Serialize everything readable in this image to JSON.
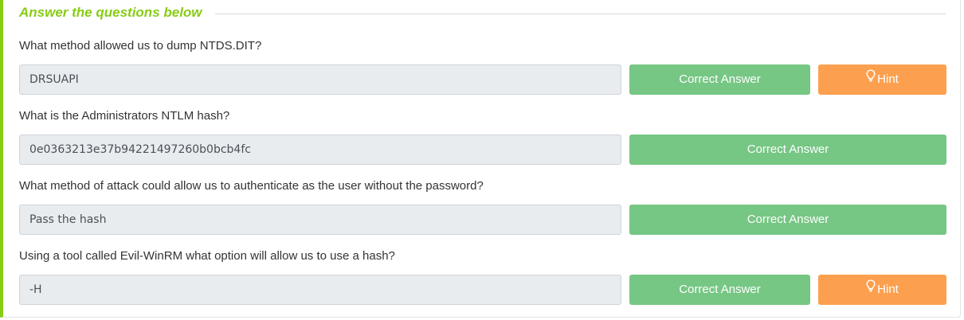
{
  "section": {
    "title": "Answer the questions below"
  },
  "questions": [
    {
      "text": "What method allowed us to dump NTDS.DIT?",
      "answer": "DRSUAPI",
      "status_label": "Correct Answer",
      "hint_label": "Hint"
    },
    {
      "text": "What is the Administrators NTLM hash?",
      "answer": "0e0363213e37b94221497260b0bcb4fc",
      "status_label": "Correct Answer"
    },
    {
      "text": "What method of attack could allow us to authenticate as the user without the password?",
      "answer": "Pass the hash",
      "status_label": "Correct Answer"
    },
    {
      "text": "Using a tool called Evil-WinRM what option will allow us to use a hash?",
      "answer": "-H",
      "status_label": "Correct Answer",
      "hint_label": "Hint"
    }
  ],
  "colors": {
    "accent_green": "#88cc14",
    "correct_button": "#76c684",
    "hint_button": "#fca04f",
    "answer_box": "#e9ecef"
  },
  "icons": {
    "hint": "lightbulb-icon"
  }
}
